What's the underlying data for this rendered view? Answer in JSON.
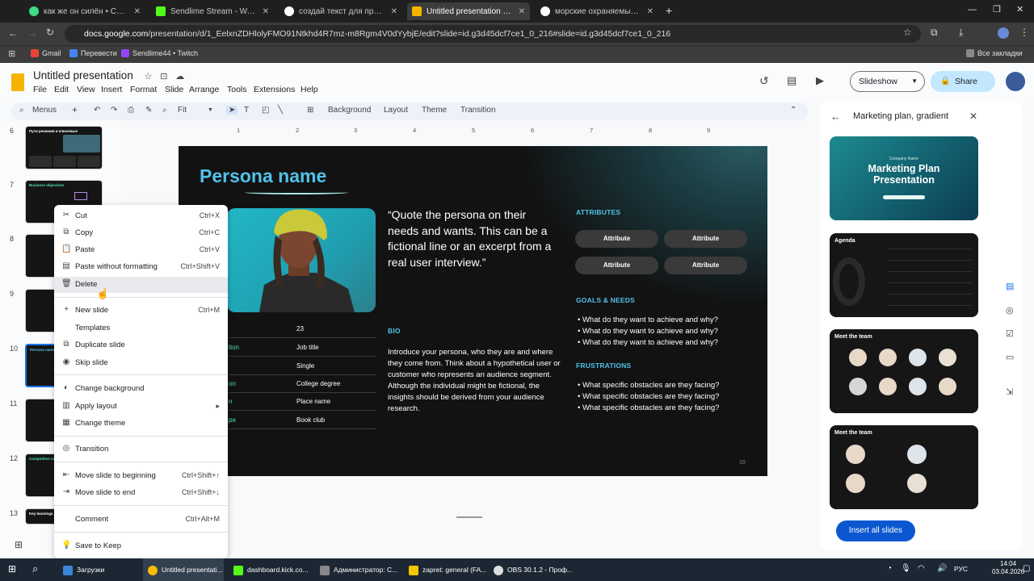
{
  "browser": {
    "tabs": [
      {
        "title": "как же он силён • СЕРЕГА",
        "color": "#3ddc84",
        "active": false
      },
      {
        "title": "Sendlime Stream - Watch Live",
        "color": "#53fc18",
        "active": false
      },
      {
        "title": "создай текст для презентации",
        "color": "#ffffff",
        "active": false
      },
      {
        "title": "Untitled presentation - Google",
        "color": "#f4b400",
        "active": true
      },
      {
        "title": "морские охраняемые районы",
        "color": "#ffffff",
        "active": false
      }
    ],
    "url_host": "docs.google.com",
    "url_path": "/presentation/d/1_EelxnZDHlolyFMO91Ntkhd4R7mz-m8Rgm4V0dYybjE/edit?slide=id.g3d45dcf7ce1_0_216#slide=id.g3d45dcf7ce1_0_216",
    "bookmarks": [
      "Gmail",
      "Перевести",
      "Sendlime44 • Twitch"
    ],
    "all_bookmarks": "Все закладки"
  },
  "docs": {
    "title": "Untitled presentation",
    "menus": [
      "File",
      "Edit",
      "View",
      "Insert",
      "Format",
      "Slide",
      "Arrange",
      "Tools",
      "Extensions",
      "Help"
    ],
    "slideshow": "Slideshow",
    "share": "Share",
    "toolbar": {
      "menus": "Menus",
      "zoom": "Fit",
      "background": "Background",
      "layout": "Layout",
      "theme": "Theme",
      "transition": "Transition"
    },
    "ruler": [
      "1",
      "2",
      "3",
      "4",
      "5",
      "6",
      "7",
      "8",
      "9"
    ]
  },
  "filmstrip": [
    {
      "num": "6",
      "label": "Пути решения и ключевые"
    },
    {
      "num": "7",
      "label": "Business objectives"
    },
    {
      "num": "8",
      "label": ""
    },
    {
      "num": "9",
      "label": ""
    },
    {
      "num": "10",
      "label": "Persona name"
    },
    {
      "num": "11",
      "label": ""
    },
    {
      "num": "12",
      "label": "Competitive overview"
    },
    {
      "num": "13",
      "label": "Key learnings and opportunities"
    }
  ],
  "slide": {
    "persona_name": "Persona name",
    "quote": "“Quote the persona on their needs and wants. This can be a fictional line or an excerpt from a real user interview.”",
    "bio_heading": "BIO",
    "bio": "Introduce your persona, who they are and where they come from. Think about a hypothetical user or customer who represents an audience segment. Although the individual might be fictional, the insights should be derived from your audience research.",
    "attributes_heading": "ATTRIBUTES",
    "attributes": [
      "Attribute",
      "Attribute",
      "Attribute",
      "Attribute"
    ],
    "goals_heading": "GOALS & NEEDS",
    "goals": [
      "What do they want to achieve and why?",
      "What do they want to achieve and why?",
      "What do they want to achieve and why?"
    ],
    "frustrations_heading": "FRUSTRATIONS",
    "frustrations": [
      "What specific obstacles are they facing?",
      "What specific obstacles are they facing?",
      "What specific obstacles are they facing?"
    ],
    "table": [
      {
        "key": "",
        "value": "23"
      },
      {
        "key": "tion",
        "value": "Job title"
      },
      {
        "key": "",
        "value": "Single"
      },
      {
        "key": "on",
        "value": "College degree"
      },
      {
        "key": "n",
        "value": "Place name"
      },
      {
        "key": "pe",
        "value": "Book club"
      }
    ],
    "number": "10"
  },
  "context_menu": {
    "items": [
      {
        "label": "Cut",
        "shortcut": "Ctrl+X",
        "icon": "scissors-icon"
      },
      {
        "label": "Copy",
        "shortcut": "Ctrl+C",
        "icon": "copy-icon"
      },
      {
        "label": "Paste",
        "shortcut": "Ctrl+V",
        "icon": "paste-icon"
      },
      {
        "label": "Paste without formatting",
        "shortcut": "Ctrl+Shift+V",
        "icon": "paste-plain-icon"
      },
      {
        "label": "Delete",
        "shortcut": "",
        "icon": "trash-icon"
      },
      {
        "label": "New slide",
        "shortcut": "Ctrl+M",
        "icon": "plus-icon"
      },
      {
        "label": "Templates",
        "shortcut": "",
        "icon": "templates-icon"
      },
      {
        "label": "Duplicate slide",
        "shortcut": "",
        "icon": "duplicate-icon"
      },
      {
        "label": "Skip slide",
        "shortcut": "",
        "icon": "eye-icon"
      },
      {
        "label": "Change background",
        "shortcut": "",
        "icon": "background-icon"
      },
      {
        "label": "Apply layout",
        "shortcut": "▸",
        "icon": "layout-icon"
      },
      {
        "label": "Change theme",
        "shortcut": "",
        "icon": "theme-icon"
      },
      {
        "label": "Transition",
        "shortcut": "",
        "icon": "transition-icon"
      },
      {
        "label": "Move slide to beginning",
        "shortcut": "Ctrl+Shift+↑",
        "icon": "move-start-icon"
      },
      {
        "label": "Move slide to end",
        "shortcut": "Ctrl+Shift+↓",
        "icon": "move-end-icon"
      },
      {
        "label": "Comment",
        "shortcut": "Ctrl+Alt+M",
        "icon": "comment-icon"
      },
      {
        "label": "Save to Keep",
        "shortcut": "",
        "icon": "keep-icon"
      }
    ]
  },
  "right_panel": {
    "title": "Marketing plan, gradient",
    "templates": [
      {
        "title": "Marketing Plan Presentation",
        "subtitle": "Company Name"
      },
      {
        "title": "Agenda",
        "subtitle": ""
      },
      {
        "title": "Meet the team",
        "subtitle": ""
      },
      {
        "title": "Meet the team",
        "subtitle": ""
      }
    ],
    "insert_all": "Insert all slides"
  },
  "taskbar": {
    "items": [
      {
        "label": "Загрузки",
        "color": "#3a86d8"
      },
      {
        "label": "Untitled presentati...",
        "color": "#fbbc05"
      },
      {
        "label": "dashboard.kick.co...",
        "color": "#53fc18"
      },
      {
        "label": "Администратор: C...",
        "color": "#888888"
      },
      {
        "label": "zapret: general (FA...",
        "color": "#f7c500"
      },
      {
        "label": "OBS 30.1.2 - Проф...",
        "color": "#dddddd"
      }
    ],
    "lang": "РУС",
    "time": "14:04",
    "date": "03.04.2026"
  }
}
